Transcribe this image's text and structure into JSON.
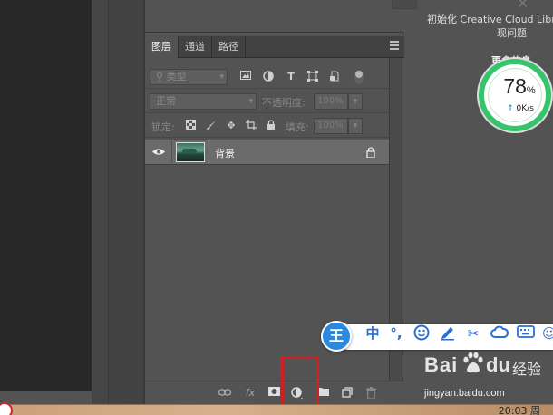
{
  "layers_panel": {
    "tabs": [
      "图层",
      "通道",
      "路径"
    ],
    "filter": {
      "kind_label": "类型",
      "icons": [
        "image-filter-icon",
        "adjustment-filter-icon",
        "type-filter-icon",
        "shape-filter-icon",
        "smart-object-filter-icon"
      ]
    },
    "blend": {
      "mode": "正常",
      "opacity_label": "不透明度:",
      "opacity_value": "100%"
    },
    "lock": {
      "label": "锁定:",
      "fill_label": "填充:",
      "fill_value": "100%"
    },
    "layers": [
      {
        "name": "背景",
        "visible": true,
        "locked": true
      }
    ],
    "bottom_icons": [
      "link-layers-icon",
      "fx-icon",
      "add-mask-icon",
      "adjustment-layer-icon",
      "new-group-icon",
      "new-layer-icon",
      "delete-icon"
    ],
    "fx_label": "fx"
  },
  "creative_cloud": {
    "line1": "初始化 Creative Cloud Libr",
    "line2": "现问题"
  },
  "speed_widget": {
    "more_label": "更多信息",
    "percent": "78",
    "percent_unit": "%",
    "speed": "0K/s",
    "ring_color": "#35c46a"
  },
  "ime_toolbar": {
    "logo": "王",
    "mode": "中",
    "items": [
      "punctuation-icon",
      "emoji-icon",
      "handwriting-icon",
      "tools-icon",
      "cloud-icon",
      "keyboard-icon"
    ]
  },
  "watermark": {
    "brand_left": "Bai",
    "brand_right": "du",
    "brand_suffix": "经验",
    "url": "jingyan.baidu.com"
  },
  "taskbar": {
    "clock": "20:03 周"
  },
  "highlight_color": "#d21f1f"
}
